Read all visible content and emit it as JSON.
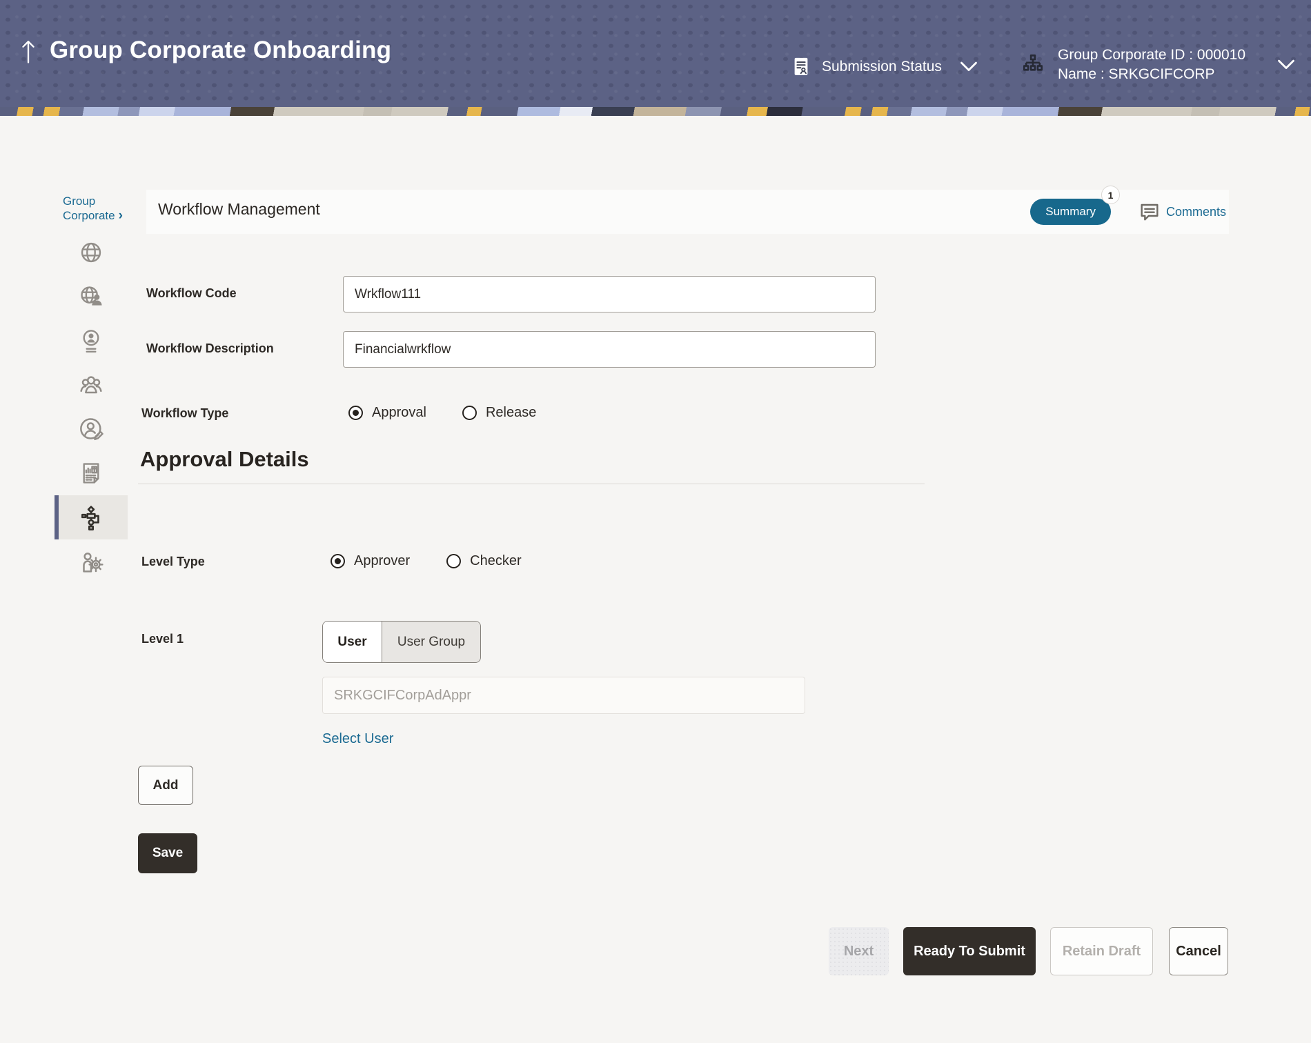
{
  "colors": {
    "header_bg": "#5c6285",
    "accent_teal": "#17688c",
    "link_blue": "#1b6a92",
    "primary_button_bg": "#332e29",
    "page_bg": "#f6f5f3",
    "sidebar_selected_bg": "#e9e7e3"
  },
  "header": {
    "title": "Group Corporate Onboarding",
    "submission_status": "Submission Status",
    "corp_id": "Group Corporate ID : 000010",
    "corp_name": "Name : SRKGCIFCORP"
  },
  "breadcrumb": {
    "label": "Group Corporate",
    "chevron": "›"
  },
  "titlebar": {
    "title": "Workflow Management",
    "summary": "Summary",
    "summary_badge": "1",
    "comments": "Comments"
  },
  "sidebar": {
    "items": [
      {
        "icon": "globe-icon",
        "selected": false
      },
      {
        "icon": "globe-user-icon",
        "selected": false
      },
      {
        "icon": "profile-icon",
        "selected": false
      },
      {
        "icon": "group-icon",
        "selected": false
      },
      {
        "icon": "user-edit-icon",
        "selected": false
      },
      {
        "icon": "report-icon",
        "selected": false
      },
      {
        "icon": "workflow-icon",
        "selected": true
      },
      {
        "icon": "user-settings-icon",
        "selected": false
      }
    ]
  },
  "form": {
    "code_label": "Workflow Code",
    "code_value": "Wrkflow111",
    "desc_label": "Workflow Description",
    "desc_value": "Financialwrkflow",
    "type_label": "Workflow Type",
    "type_options": [
      "Approval",
      "Release"
    ],
    "type_selected": "Approval",
    "section_title": "Approval Details",
    "level_type_label": "Level Type",
    "level_type_options": [
      "Approver",
      "Checker"
    ],
    "level_type_selected": "Approver",
    "level1_label": "Level 1",
    "level1_tabs": [
      "User",
      "User Group"
    ],
    "level1_active_tab": "User",
    "user_placeholder": "SRKGCIFCorpAdAppr",
    "select_user": "Select User",
    "add": "Add",
    "save": "Save"
  },
  "footer": {
    "next": "Next",
    "ready": "Ready To Submit",
    "retain": "Retain Draft",
    "cancel": "Cancel"
  }
}
